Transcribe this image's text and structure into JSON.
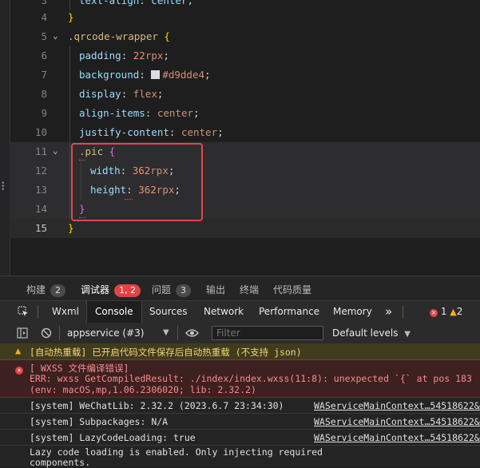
{
  "editor": {
    "lines": [
      {
        "n": "3",
        "text": "text-align: center;"
      },
      {
        "n": "4",
        "text": "}"
      },
      {
        "n": "5",
        "selector": ".qrcode-wrapper",
        "brace": "{"
      },
      {
        "n": "6",
        "prop": "padding",
        "num": "22",
        "unit": "rpx",
        "end": ";"
      },
      {
        "n": "7",
        "prop": "background",
        "color_value": "#d9dde4",
        "end": ";"
      },
      {
        "n": "8",
        "prop": "display",
        "value": "flex",
        "end": ";"
      },
      {
        "n": "9",
        "prop": "align-items",
        "value": "center",
        "end": ";"
      },
      {
        "n": "10",
        "prop": "justify-content",
        "value": "center",
        "end": ";"
      },
      {
        "n": "11",
        "selector": ".pic",
        "brace": "{"
      },
      {
        "n": "12",
        "prop": "width",
        "num": "362",
        "unit": "rpx",
        "end": ";"
      },
      {
        "n": "13",
        "prop": "height",
        "num": "362",
        "unit": "rpx",
        "end": ";"
      },
      {
        "n": "14",
        "text": "}"
      },
      {
        "n": "15",
        "text": "}"
      }
    ],
    "colon": ":"
  },
  "panel": {
    "tabs": [
      {
        "label": "构建",
        "badge": "2"
      },
      {
        "label": "调试器",
        "badge": "1, 2"
      },
      {
        "label": "问题",
        "badge": "3"
      },
      {
        "label": "输出"
      },
      {
        "label": "终端"
      },
      {
        "label": "代码质量"
      }
    ]
  },
  "devtools": {
    "tabs": [
      "Wxml",
      "Console",
      "Sources",
      "Network",
      "Performance",
      "Memory"
    ],
    "more": "»",
    "error_count": "1",
    "warning_count": "2",
    "context": "appservice (#3)",
    "filter_placeholder": "Filter",
    "levels": "Default levels"
  },
  "console": {
    "warning": "[自动热重载] 已开启代码文件保存后自动热重载 (不支持 json)",
    "error_lines": [
      "[ WXSS 文件编译错误]",
      "ERR: wxss GetCompiledResult: ./index/index.wxss(11:8): unexpected `{` at pos 183",
      "(env: macOS,mp,1.06.2306020; lib: 2.32.2)"
    ],
    "logs": [
      {
        "text": "[system] WeChatLib: 2.32.2 (2023.6.7 23:34:30)",
        "source": "WAServiceMainContext…54518622&v="
      },
      {
        "text": "[system] Subpackages: N/A",
        "source": "WAServiceMainContext…54518622&v="
      },
      {
        "text": "[system] LazyCodeLoading: true",
        "source": "WAServiceMainContext…54518622&v="
      }
    ],
    "lazy_lines": [
      "Lazy code loading is enabled. Only injecting required",
      "components."
    ]
  }
}
